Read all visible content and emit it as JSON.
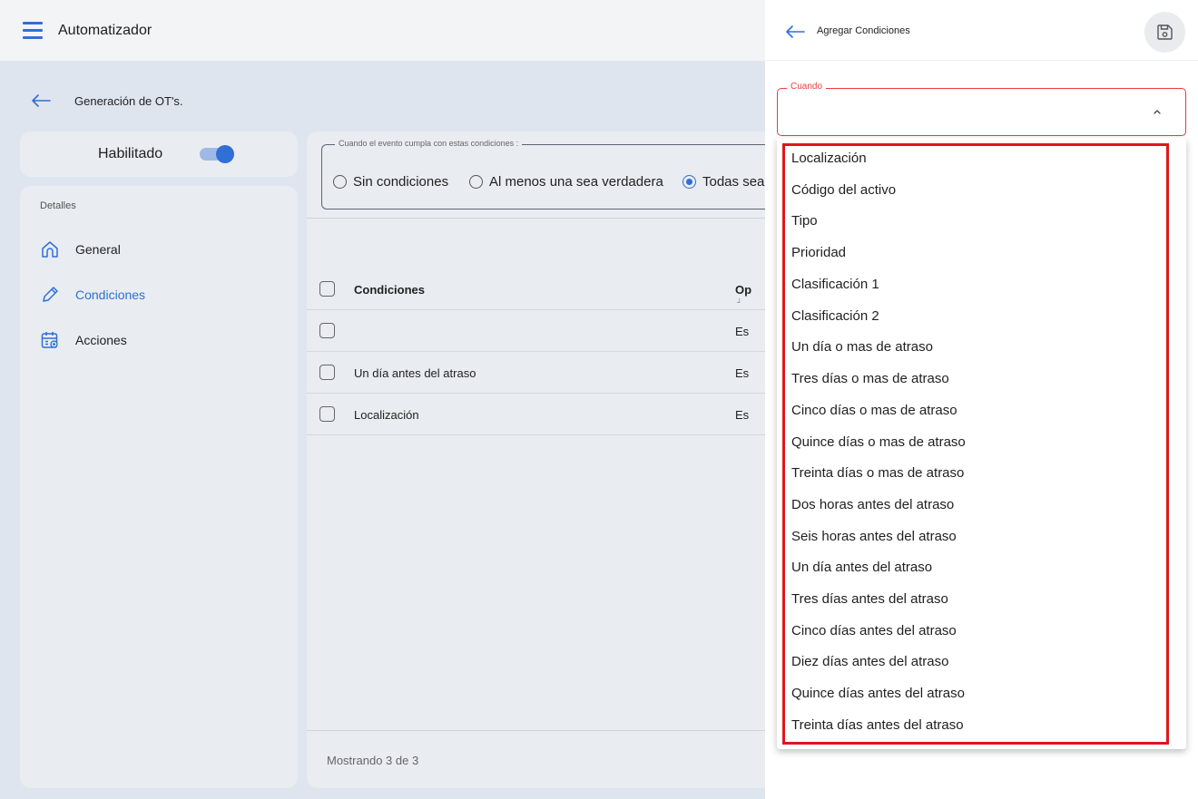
{
  "app": {
    "title": "Automatizador",
    "breadcrumb": "Generación de OT's."
  },
  "enable": {
    "label": "Habilitado",
    "enabled": true
  },
  "sidebar": {
    "heading": "Detalles",
    "items": [
      {
        "label": "General",
        "icon": "home-icon",
        "active": false
      },
      {
        "label": "Condiciones",
        "icon": "pencil-icon",
        "active": true
      },
      {
        "label": "Acciones",
        "icon": "calendar-add-icon",
        "active": false
      }
    ]
  },
  "conditions": {
    "legend": "Cuando el evento cumpla con estas condiciones :",
    "radios": [
      {
        "label": "Sin condiciones",
        "selected": false
      },
      {
        "label": "Al menos una sea verdadera",
        "selected": false
      },
      {
        "label": "Todas sea",
        "selected": true
      }
    ],
    "table": {
      "columns": [
        "Condiciones",
        "Op"
      ],
      "rows": [
        {
          "condition": "",
          "op": "Es"
        },
        {
          "condition": "Un día antes del atraso",
          "op": "Es"
        },
        {
          "condition": "Localización",
          "op": "Es"
        }
      ]
    },
    "footer": "Mostrando 3 de 3"
  },
  "drawer": {
    "title": "Agregar Condiciones",
    "field_label": "Cuando",
    "field_value": "",
    "options": [
      "Localización",
      "Código del activo",
      "Tipo",
      "Prioridad",
      "Clasificación 1",
      "Clasificación 2",
      "Un día o mas de atraso",
      "Tres días o mas de atraso",
      "Cinco días o mas de atraso",
      "Quince días o mas de atraso",
      "Treinta días o mas de atraso",
      "Dos horas antes del atraso",
      "Seis horas antes del atraso",
      "Un día antes del atraso",
      "Tres días antes del atraso",
      "Cinco días antes del atraso",
      "Diez días antes del atraso",
      "Quince días antes del atraso",
      "Treinta días antes del atraso"
    ]
  },
  "colors": {
    "accent": "#2f6fd6",
    "error": "#e53e3e",
    "highlight": "#e0161d"
  }
}
